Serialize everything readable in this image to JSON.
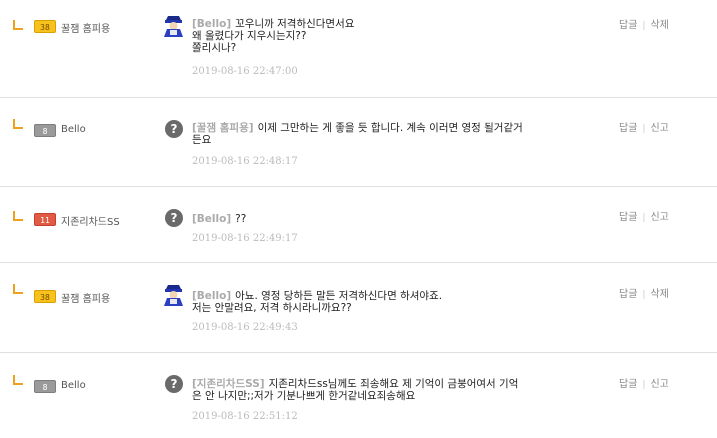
{
  "comments": [
    {
      "level": "38",
      "nickname": "꿀잼 홈피용",
      "author": "[Bello]",
      "text_lines": [
        "꼬우니까 저격하신다면서요",
        "왜 올렸다가 지우시는지??",
        "쫄리시나?"
      ],
      "date": "2019-08-16 22:47:00",
      "reply_label": "답글",
      "action_label": "삭제"
    },
    {
      "level": "8",
      "nickname": "Bello",
      "author": "[꿀잼 홈피용]",
      "text_lines": [
        "이제 그만하는 게 좋을 듯 합니다. 계속 이러면 영정 될거같거",
        "든요"
      ],
      "date": "2019-08-16 22:48:17",
      "reply_label": "답글",
      "action_label": "신고"
    },
    {
      "level": "11",
      "nickname": "지존리차드SS",
      "author": "[Bello]",
      "text_lines": [
        "??"
      ],
      "date": "2019-08-16 22:49:17",
      "reply_label": "답글",
      "action_label": "신고"
    },
    {
      "level": "38",
      "nickname": "꿀잼 홈피용",
      "author": "[Bello]",
      "text_lines": [
        "아뇨. 영정 당하든 말든 저격하신다면 하셔야죠.",
        "저는 안말려요, 저격 하시라니까요??"
      ],
      "date": "2019-08-16 22:49:43",
      "reply_label": "답글",
      "action_label": "삭제"
    },
    {
      "level": "8",
      "nickname": "Bello",
      "author": "[지존리차드SS]",
      "text_lines": [
        "지존리차드ss님께도 죄송해요 제 기억이 금붕어여서 기억",
        "은 안 나지만;;저가 기분나쁘게 한거같네요죄송해요"
      ],
      "date": "2019-08-16 22:51:12",
      "reply_label": "답글",
      "action_label": "신고"
    }
  ]
}
